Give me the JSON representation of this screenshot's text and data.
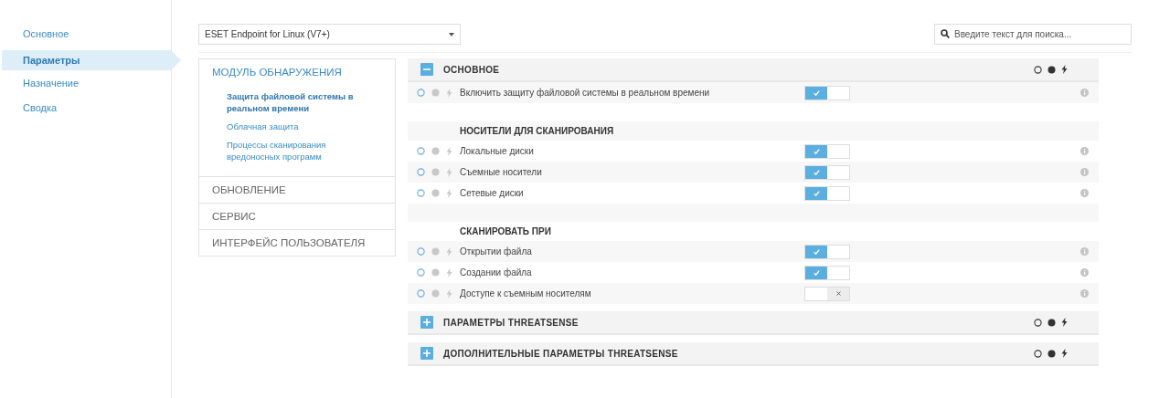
{
  "nav": [
    {
      "label": "Основное",
      "selected": false
    },
    {
      "label": "Параметры",
      "selected": true
    },
    {
      "label": "Назначение",
      "selected": false
    },
    {
      "label": "Сводка",
      "selected": false
    }
  ],
  "product_select": {
    "value": "ESET Endpoint for Linux (V7+)"
  },
  "search": {
    "placeholder": "Введите текст для поиска..."
  },
  "categories": [
    {
      "label": "МОДУЛЬ ОБНАРУЖЕНИЯ",
      "expanded": true,
      "children": [
        {
          "label": "Защита файловой системы в реальном времени",
          "selected": true
        },
        {
          "label": "Облачная защита",
          "selected": false
        },
        {
          "label": "Процессы сканирования вредоносных программ",
          "selected": false
        }
      ]
    },
    {
      "label": "ОБНОВЛЕНИЕ",
      "expanded": false
    },
    {
      "label": "СЕРВИС",
      "expanded": false
    },
    {
      "label": "ИНТЕРФЕЙС ПОЛЬЗОВАТЕЛЯ",
      "expanded": false
    }
  ],
  "sections": [
    {
      "title": "ОСНОВНОЕ",
      "expanded": true,
      "groups": [
        {
          "rows": [
            {
              "label": "Включить защиту файловой системы в реальном времени",
              "on": true
            }
          ]
        },
        {
          "title": "НОСИТЕЛИ ДЛЯ СКАНИРОВАНИЯ",
          "rows": [
            {
              "label": "Локальные диски",
              "on": true
            },
            {
              "label": "Съемные носители",
              "on": true
            },
            {
              "label": "Сетевые диски",
              "on": true
            }
          ]
        },
        {
          "title": "СКАНИРОВАТЬ ПРИ",
          "rows": [
            {
              "label": "Открытии файла",
              "on": true
            },
            {
              "label": "Создании файла",
              "on": true
            },
            {
              "label": "Доступе к съемным носителям",
              "on": false
            }
          ]
        }
      ]
    },
    {
      "title": "ПАРАМЕТРЫ THREATSENSE",
      "expanded": false
    },
    {
      "title": "ДОПОЛНИТЕЛЬНЫЕ ПАРАМЕТРЫ THREATSENSE",
      "expanded": false
    }
  ]
}
